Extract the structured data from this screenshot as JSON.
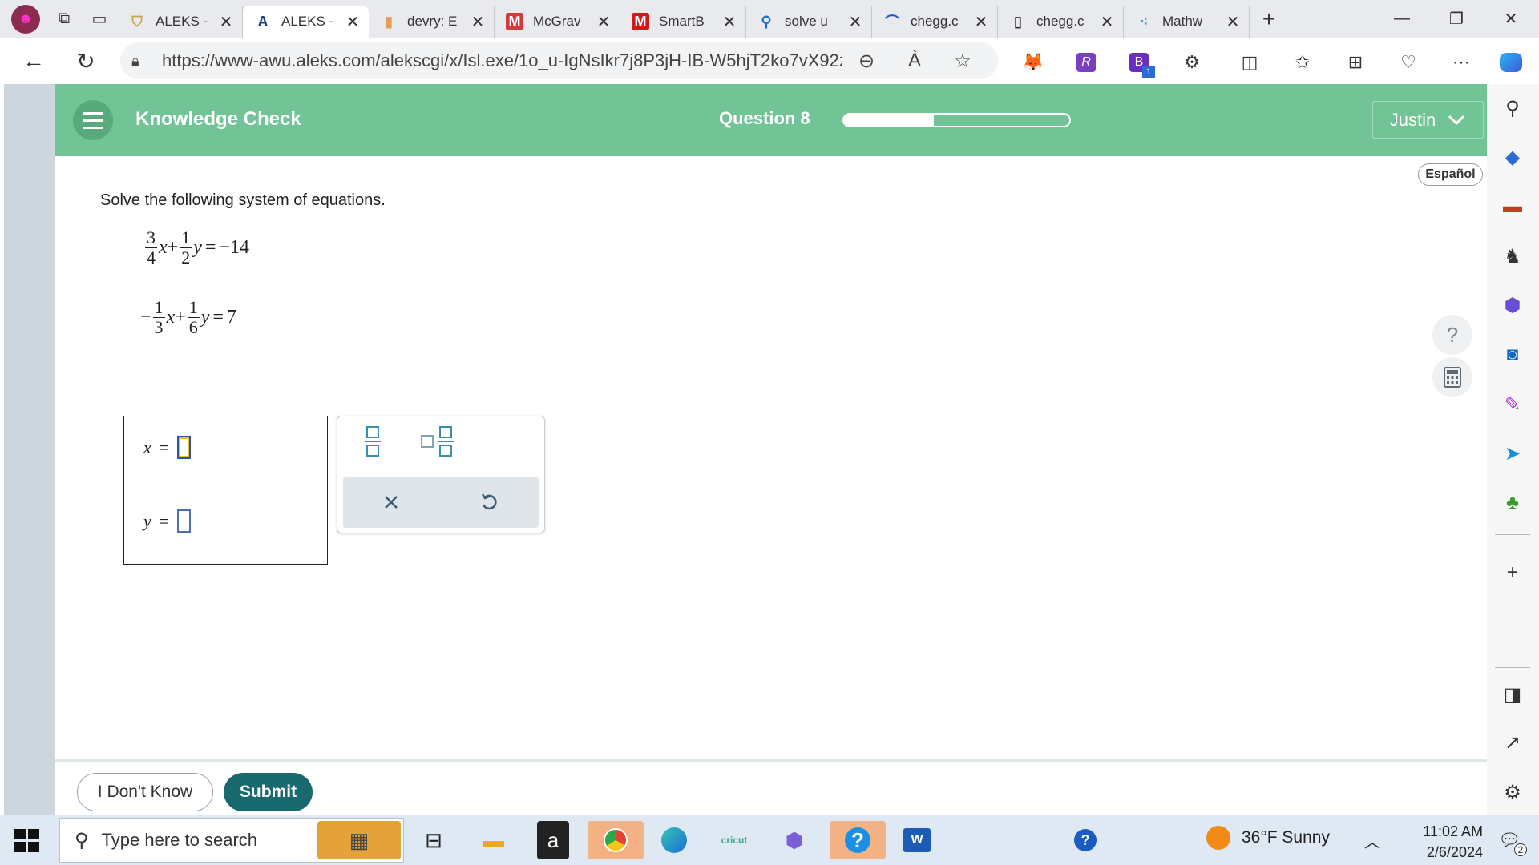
{
  "browser": {
    "tabs": [
      {
        "title": "ALEKS -",
        "favicon": "aleks-shield",
        "favicon_color": "#c9a24a"
      },
      {
        "title": "ALEKS -",
        "favicon": "aleks-a",
        "favicon_color": "#1a3c8c",
        "active": true
      },
      {
        "title": "devry: E",
        "favicon": "book",
        "favicon_color": "#e2a05a"
      },
      {
        "title": "McGrav",
        "favicon": "M",
        "favicon_color": "#d43a3a"
      },
      {
        "title": "SmartB",
        "favicon": "M",
        "favicon_color": "#d01a1a"
      },
      {
        "title": "solve u",
        "favicon": "search",
        "favicon_color": "#1a6fd6"
      },
      {
        "title": "chegg.c",
        "favicon": "chegg",
        "favicon_color": "#1a5cc4"
      },
      {
        "title": "chegg.c",
        "favicon": "page",
        "favicon_color": "#333333"
      },
      {
        "title": "Mathw",
        "favicon": "dots",
        "favicon_color": "#1aa1e2"
      }
    ],
    "url": "https://www-awu.aleks.com/alekscgi/x/Isl.exe/1o_u-IgNsIkr7j8P3jH-IB-W5hjT2ko7vX92zF...",
    "read_aloud": "À",
    "ext_badge": "1"
  },
  "aleks": {
    "section_title": "Knowledge Check",
    "question_label": "Question 8",
    "progress": 0.4,
    "user": "Justin",
    "language_button": "Español",
    "instruction": "Solve the following system of equations.",
    "equations": [
      {
        "sign": "",
        "a_num": "3",
        "a_den": "4",
        "b_num": "1",
        "b_den": "2",
        "rhs": "−14"
      },
      {
        "sign": "−",
        "a_num": "1",
        "a_den": "3",
        "b_num": "1",
        "b_den": "6",
        "rhs": "7"
      }
    ],
    "answer": {
      "x_label": "x",
      "y_label": "y",
      "equals": "="
    },
    "buttons": {
      "dont_know": "I Don't Know",
      "submit": "Submit"
    },
    "help": "?"
  },
  "taskbar": {
    "search_placeholder": "Type here to search",
    "weather": "36°F  Sunny",
    "time": "11:02 AM",
    "date": "2/6/2024",
    "notification_count": "2"
  }
}
